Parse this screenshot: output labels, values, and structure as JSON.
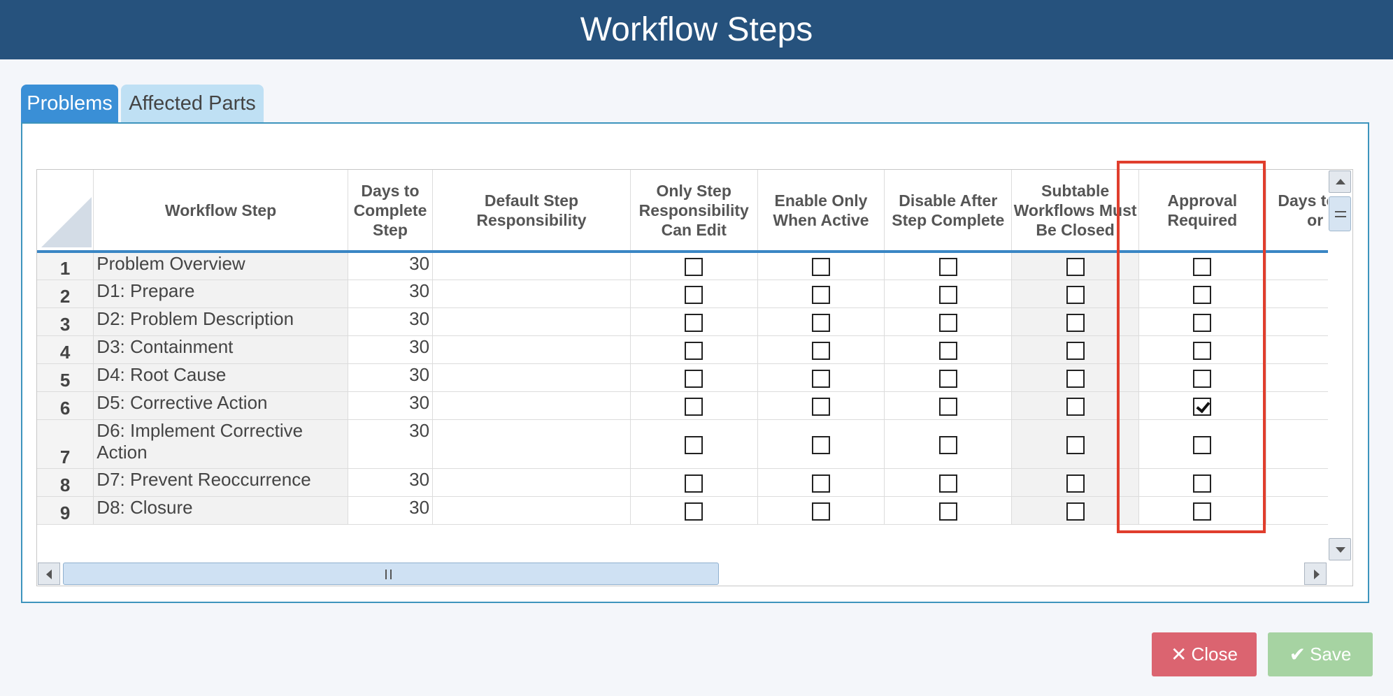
{
  "header": {
    "title": "Workflow Steps"
  },
  "tabs": [
    {
      "label": "Problems",
      "active": true
    },
    {
      "label": "Affected Parts",
      "active": false
    }
  ],
  "table": {
    "columns": [
      "Workflow Step",
      "Days to Complete Step",
      "Default Step Responsibility",
      "Only Step Responsibility Can Edit",
      "Enable Only When Active",
      "Disable After Step Complete",
      "Subtable Workflows Must Be Closed",
      "Approval Required",
      "Days to Approve or Reject"
    ],
    "rows": [
      {
        "num": "1",
        "step": "Problem Overview",
        "days": "30",
        "approval": false
      },
      {
        "num": "2",
        "step": "D1: Prepare",
        "days": "30",
        "approval": false
      },
      {
        "num": "3",
        "step": "D2: Problem Description",
        "days": "30",
        "approval": false
      },
      {
        "num": "4",
        "step": "D3: Containment",
        "days": "30",
        "approval": false
      },
      {
        "num": "5",
        "step": "D4: Root Cause",
        "days": "30",
        "approval": false
      },
      {
        "num": "6",
        "step": "D5: Corrective Action",
        "days": "30",
        "approval": true
      },
      {
        "num": "7",
        "step": "D6: Implement Corrective Action",
        "days": "30",
        "approval": false
      },
      {
        "num": "8",
        "step": "D7: Prevent Reoccurrence",
        "days": "30",
        "approval": false
      },
      {
        "num": "9",
        "step": "D8: Closure",
        "days": "30",
        "approval": false
      }
    ]
  },
  "buttons": {
    "close_label": "Close",
    "save_label": "Save"
  },
  "icons": {
    "close": "close-x-icon",
    "save": "checkmark-icon"
  },
  "colors": {
    "header_bg": "#26527d",
    "tab_active": "#3a8fd6",
    "tab_inactive": "#bfe0f4",
    "highlight_border": "#e03e2d",
    "close_button": "#db6470",
    "save_button": "#a6d3a2"
  }
}
